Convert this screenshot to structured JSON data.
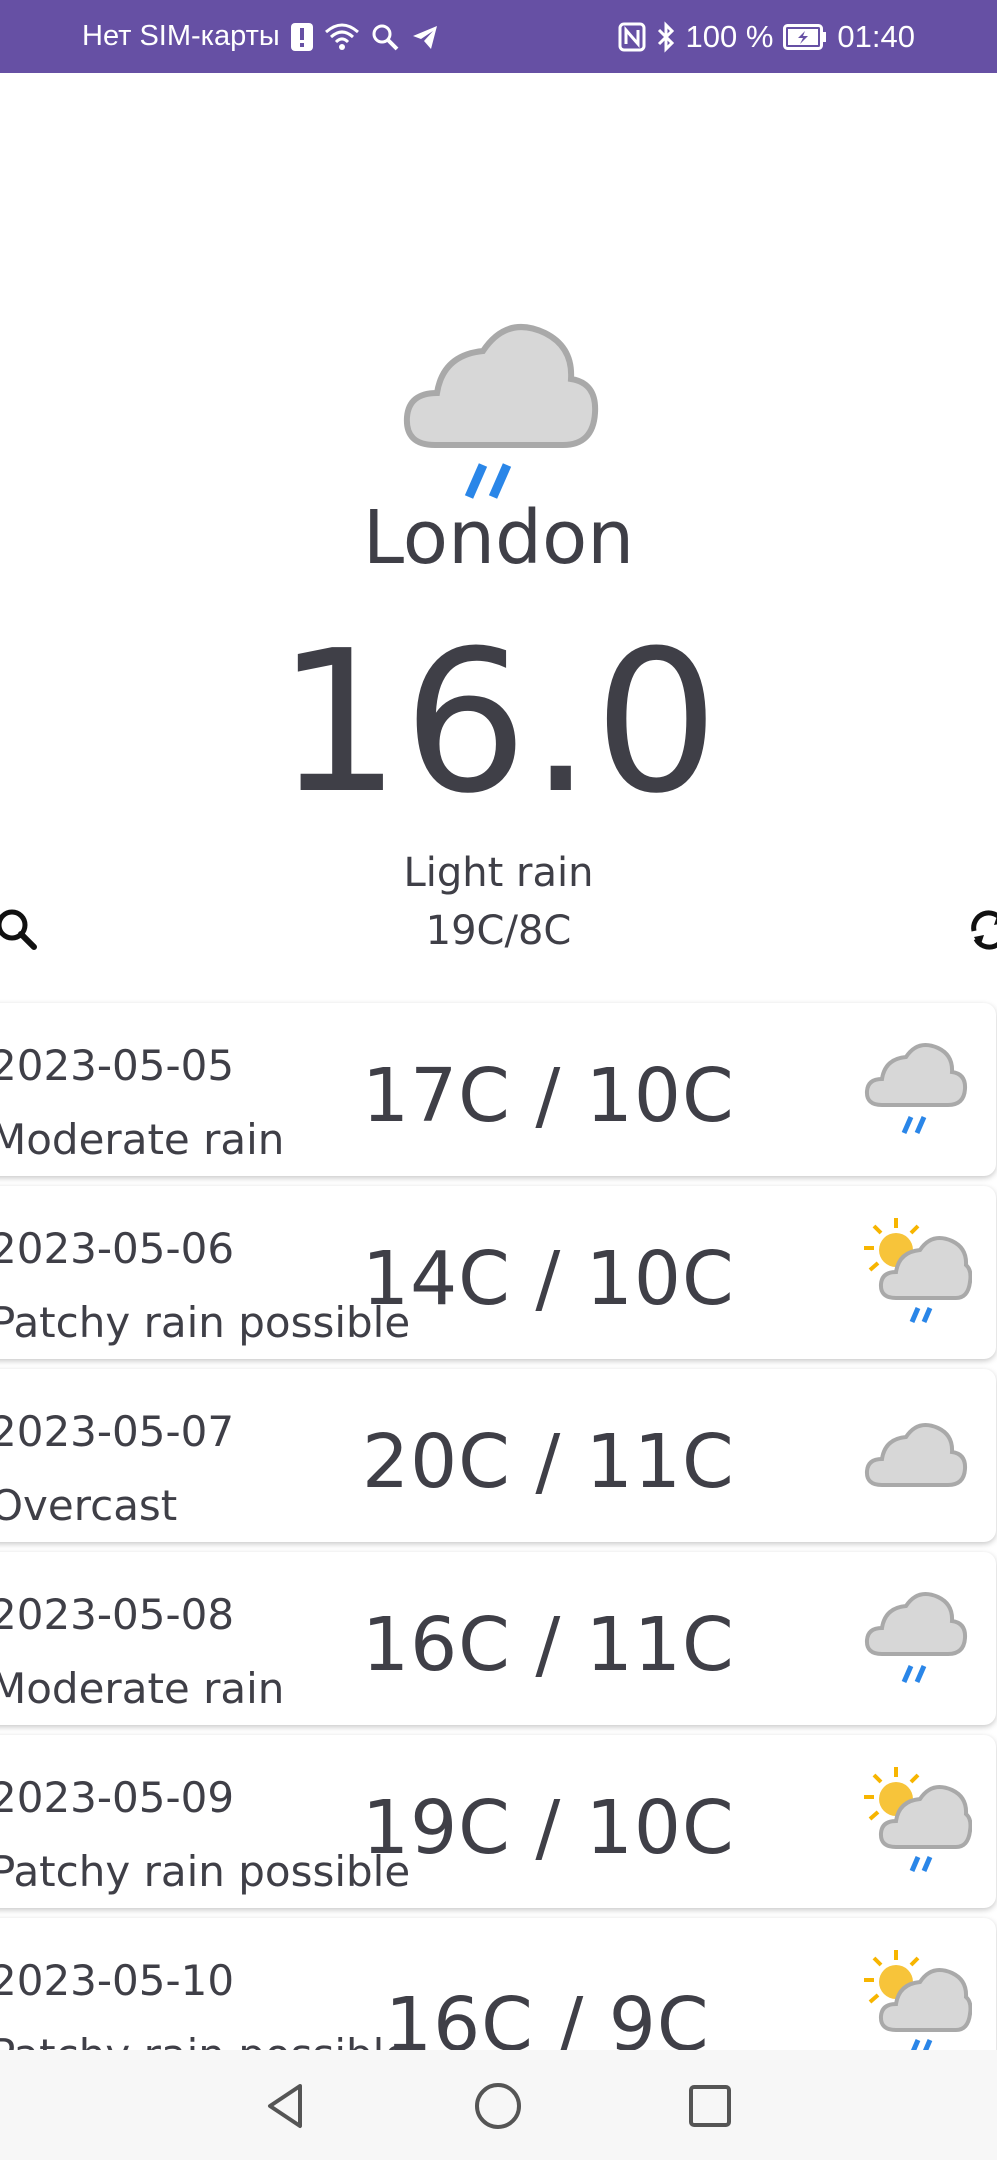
{
  "status_bar": {
    "carrier": "Нет SIM-карты",
    "battery": "100 %",
    "time": "01:40",
    "background": "#6650a4"
  },
  "current": {
    "icon": "light-rain-cloud-icon",
    "city": "London",
    "temperature": "16.0",
    "condition": "Light rain",
    "high_low": "19C/8C"
  },
  "actions": {
    "search_icon": "search-icon",
    "refresh_icon": "refresh-icon"
  },
  "forecast": [
    {
      "date": "2023-05-05",
      "description": "Moderate rain",
      "range": "17C / 10C",
      "icon": "rain-cloud-icon"
    },
    {
      "date": "2023-05-06",
      "description": "Patchy rain possible",
      "range": "14C / 10C",
      "icon": "sun-rain-cloud-icon"
    },
    {
      "date": "2023-05-07",
      "description": "Overcast",
      "range": "20C / 11C",
      "icon": "cloud-icon"
    },
    {
      "date": "2023-05-08",
      "description": "Moderate rain",
      "range": "16C / 11C",
      "icon": "rain-cloud-icon"
    },
    {
      "date": "2023-05-09",
      "description": "Patchy rain possible",
      "range": "19C / 10C",
      "icon": "sun-rain-cloud-icon"
    },
    {
      "date": "2023-05-10",
      "description": "Patchy rain possible",
      "range": "16C / 9C",
      "icon": "sun-rain-cloud-icon"
    }
  ],
  "colors": {
    "text": "#3f3f47",
    "cloud": "#c9c9c9",
    "rain": "#2a86e8",
    "sun": "#f7b500"
  }
}
